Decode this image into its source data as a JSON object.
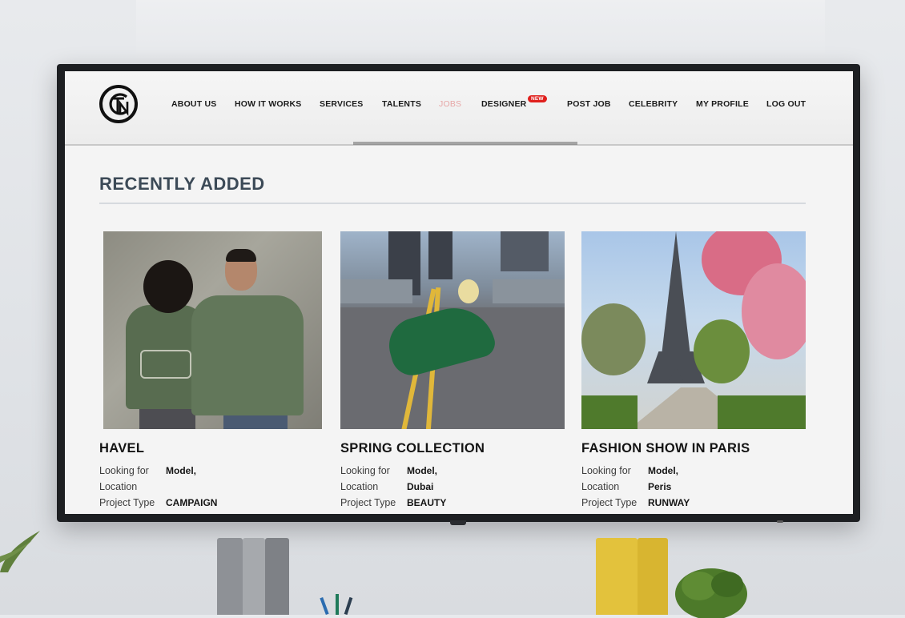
{
  "nav": {
    "logo_text": "CFN",
    "items": [
      {
        "label": "ABOUT US",
        "active": false
      },
      {
        "label": "HOW IT WORKS",
        "active": false
      },
      {
        "label": "SERVICES",
        "active": false
      },
      {
        "label": "TALENTS",
        "active": false
      },
      {
        "label": "JOBS",
        "active": true
      },
      {
        "label": "DESIGNER",
        "active": false,
        "badge": "NEW"
      },
      {
        "label": "POST JOB",
        "active": false
      },
      {
        "label": "CELEBRITY",
        "active": false
      },
      {
        "label": "MY PROFILE",
        "active": false
      },
      {
        "label": "LOG OUT",
        "active": false
      }
    ]
  },
  "section": {
    "title": "RECENTLY ADDED"
  },
  "meta_labels": {
    "looking_for": "Looking for",
    "location": "Location",
    "project_type": "Project Type"
  },
  "cards": [
    {
      "title": "HAVEL",
      "looking_for": "Model,",
      "location": "",
      "project_type": "CAMPAIGN"
    },
    {
      "title": "SPRING COLLECTION",
      "looking_for": "Model,",
      "location": "Dubai",
      "project_type": "BEAUTY"
    },
    {
      "title": "FASHION SHOW IN PARIS",
      "looking_for": "Model,",
      "location": "Peris",
      "project_type": "RUNWAY"
    }
  ],
  "colors": {
    "accent_active": "#e7a7a7",
    "badge": "#e0201d",
    "title": "#3c4a57"
  }
}
